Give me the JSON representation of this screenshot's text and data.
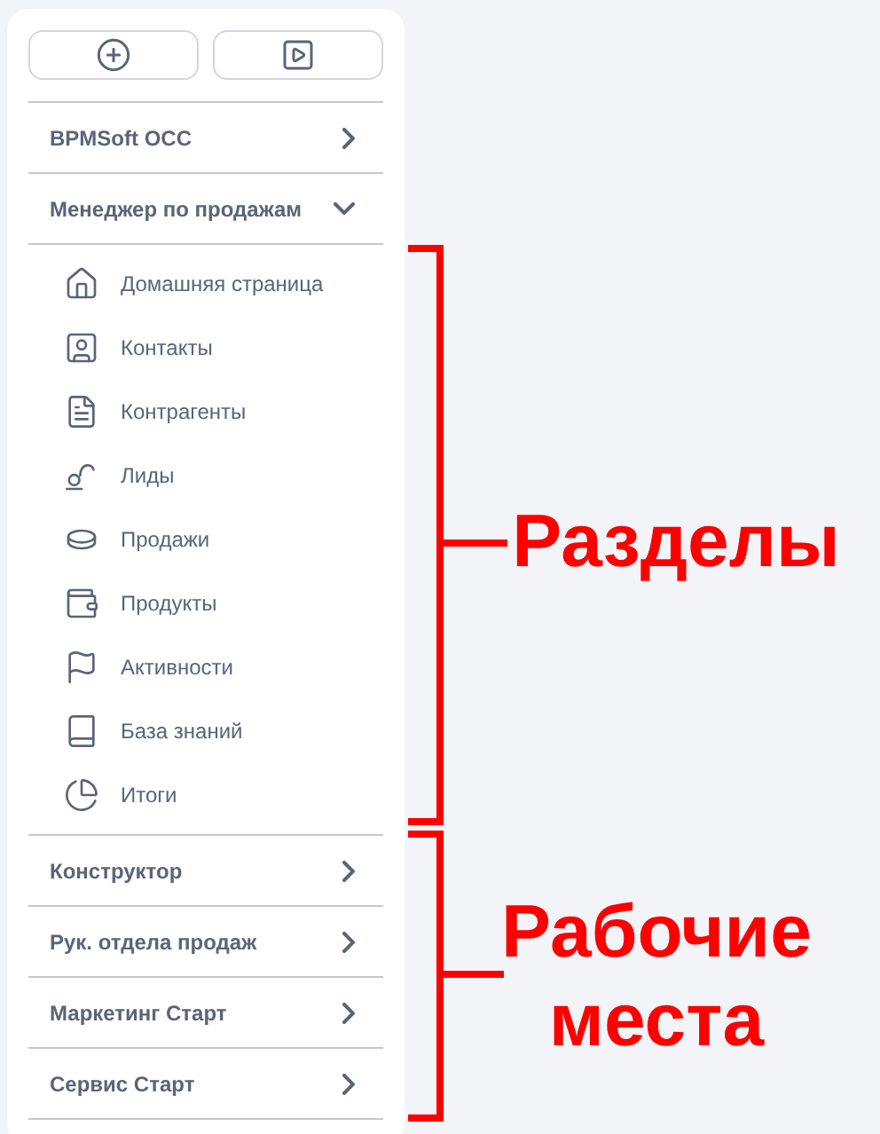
{
  "groups_top": [
    {
      "label": "BPMSoft OCC",
      "expanded": false
    },
    {
      "label": "Менеджер по продажам",
      "expanded": true,
      "children": [
        "Домашняя страница",
        "Контакты",
        "Контрагенты",
        "Лиды",
        "Продажи",
        "Продукты",
        "Активности",
        "База знаний",
        "Итоги"
      ]
    }
  ],
  "groups_bottom": [
    {
      "label": "Конструктор",
      "expanded": false
    },
    {
      "label": "Рук. отдела продаж",
      "expanded": false
    },
    {
      "label": "Маркетинг Старт",
      "expanded": false
    },
    {
      "label": "Сервис Старт",
      "expanded": false
    }
  ],
  "annotations": [
    "Разделы",
    "Рабочие места"
  ]
}
